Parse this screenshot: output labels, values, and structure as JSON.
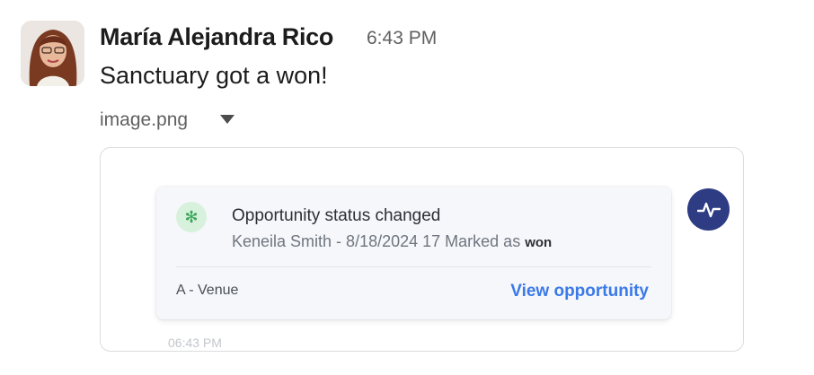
{
  "message": {
    "sender": "María Alejandra Rico",
    "time": "6:43 PM",
    "text": "Sanctuary got a won!",
    "attachment_name": "image.png"
  },
  "card": {
    "title": "Opportunity status changed",
    "subtitle_prefix": "Keneila Smith - 8/18/2024 17 Marked as",
    "status": "won",
    "venue": "A - Venue",
    "link_label": "View opportunity",
    "timestamp": "06:43 PM",
    "icon": "asterisk-icon"
  },
  "colors": {
    "link": "#3a79e8",
    "pulse_button": "#2e3c84",
    "status_icon_bg": "#d7f1dd",
    "status_icon_fg": "#3aa55a"
  }
}
